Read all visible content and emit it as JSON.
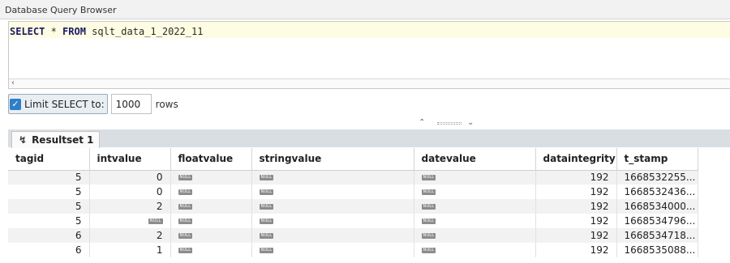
{
  "window": {
    "title": "Database Query Browser"
  },
  "query": {
    "keyword_select": "SELECT",
    "star": " * ",
    "keyword_from": "FROM",
    "table": " sqlt_data_1_2022_11"
  },
  "limit": {
    "label": "Limit SELECT to:",
    "checked": true,
    "value": "1000",
    "unit": "rows"
  },
  "tabs": [
    {
      "label": "Resultset 1",
      "icon": "lightning-icon"
    }
  ],
  "null_label": "NULL",
  "grid": {
    "columns": [
      "tagid",
      "intvalue",
      "floatvalue",
      "stringvalue",
      "datevalue",
      "dataintegrity",
      "t_stamp"
    ],
    "rows": [
      [
        "5",
        "0",
        null,
        null,
        null,
        "192",
        "1668532255..."
      ],
      [
        "5",
        "0",
        null,
        null,
        null,
        "192",
        "1668532436..."
      ],
      [
        "5",
        "2",
        null,
        null,
        null,
        "192",
        "1668534000..."
      ],
      [
        "5",
        null,
        null,
        null,
        null,
        "192",
        "1668534796..."
      ],
      [
        "6",
        "2",
        null,
        null,
        null,
        "192",
        "1668534718..."
      ],
      [
        "6",
        "1",
        null,
        null,
        null,
        "192",
        "1668535088..."
      ]
    ]
  }
}
